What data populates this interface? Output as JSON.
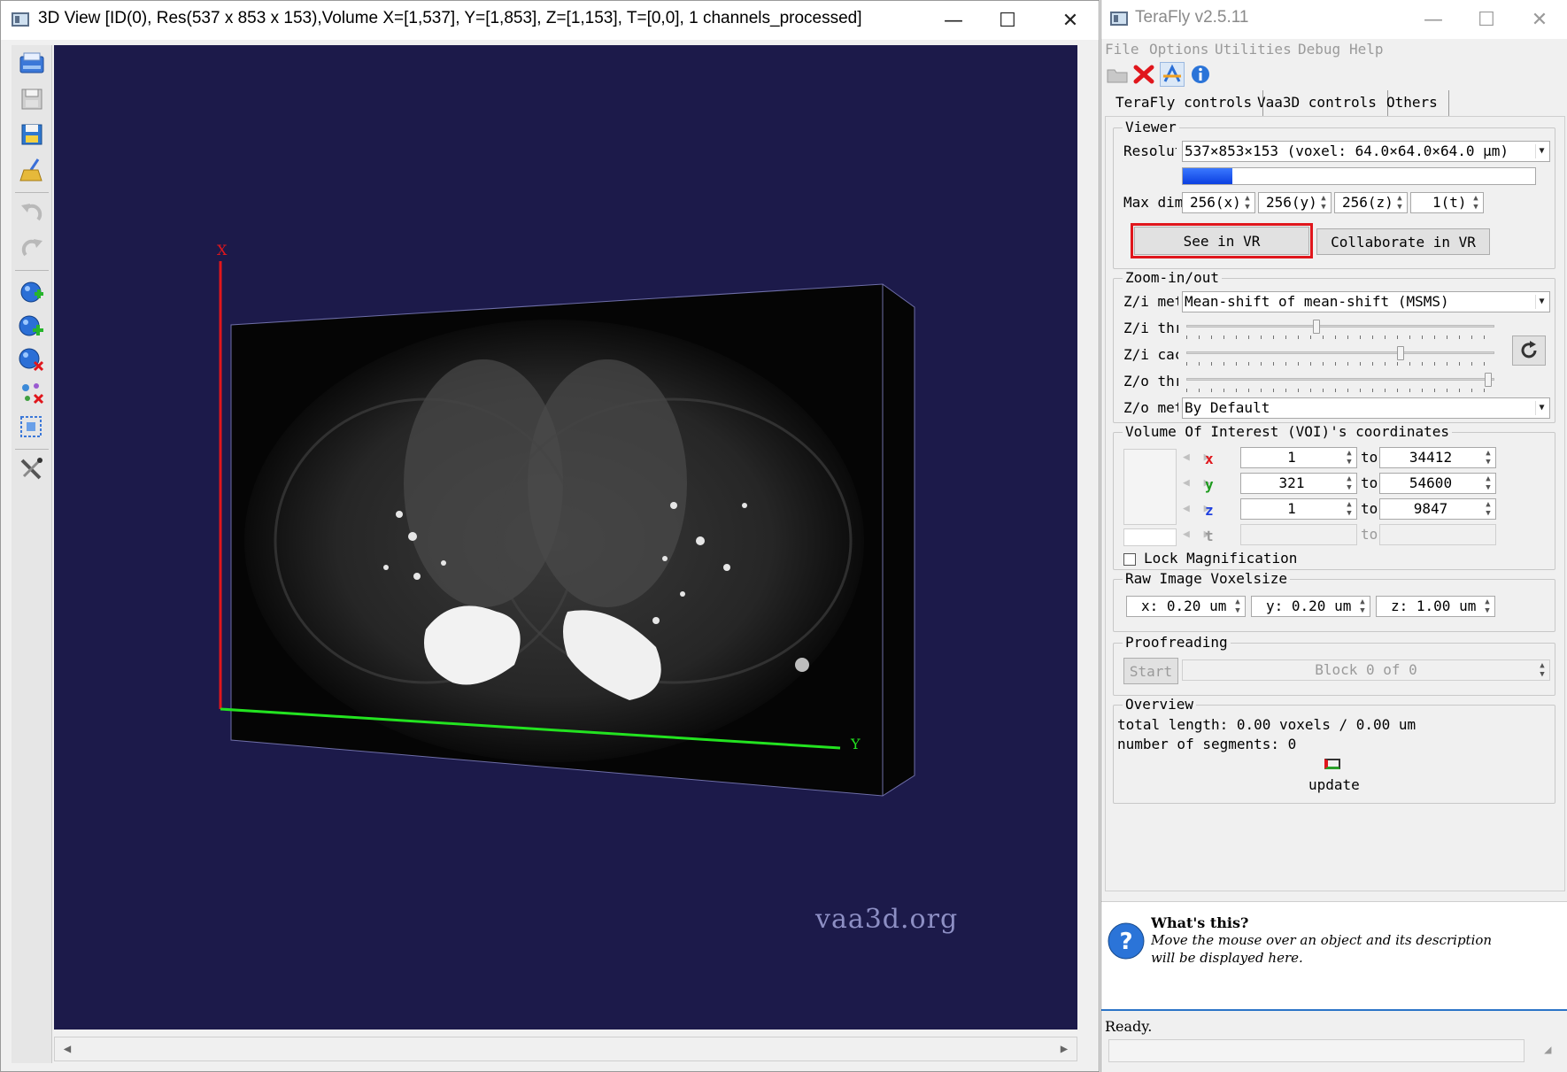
{
  "view_window": {
    "title": "3D View [ID(0), Res(537 x 853 x 153),Volume X=[1,537], Y=[1,853], Z=[1,153], T=[0,0], 1 channels_processed]",
    "minimize": "—",
    "maximize": "☐",
    "close": "✕",
    "toolbar_icons": [
      "screenshot-icon",
      "save-icon",
      "save-as-icon",
      "clean-icon",
      "undo-icon",
      "redo-icon",
      "load-surface-icon",
      "add-marker-icon",
      "delete-marker-icon",
      "neuron-tools-icon",
      "zoom-region-icon",
      "settings-icon"
    ],
    "axis_x_label": "X",
    "axis_y_label": "Y",
    "watermark": "vaa3d.org",
    "colors": {
      "background": "#1c1a4a",
      "axis_x": "#e0161c",
      "axis_y": "#23e320"
    }
  },
  "terafly": {
    "title": "TeraFly v2.5.11",
    "minimize": "—",
    "maximize": "☐",
    "close": "✕",
    "menu": [
      "File",
      "Options",
      "Utilities",
      "Debug",
      "Help"
    ],
    "tabs": [
      "TeraFly controls",
      "Vaa3D controls",
      "Others"
    ],
    "viewer": {
      "title": "Viewer",
      "resolution_label": "Resolut",
      "resolution_value": "537×853×153 (voxel: 64.0×64.0×64.0 μm)",
      "progress": 0.14,
      "maxdim_label": "Max dim",
      "maxdim": [
        "256(x)",
        "256(y)",
        "256(z)",
        "1(t)"
      ],
      "see_vr": "See in VR",
      "collaborate_vr": "Collaborate in VR",
      "highlight_color": "#e0161c"
    },
    "zoom": {
      "title": "Zoom-in/out",
      "zi_method_label": "Z/i metl",
      "zi_method_value": "Mean-shift of mean-shift (MSMS)",
      "zi_threshold_label": "Z/i thr",
      "zi_threshold": 0.42,
      "zi_cache_label": "Z/i cacl",
      "zi_cache": 0.7,
      "zo_threshold_label": "Z/o thr",
      "zo_threshold": 0.99,
      "zo_method_label": "Z/o metl",
      "zo_method_value": "By Default"
    },
    "voi": {
      "title": "Volume Of Interest (VOI)'s coordinates",
      "to": "to",
      "rows": [
        {
          "axis": "x",
          "from": "1",
          "to": "34412",
          "color": "#e0161c"
        },
        {
          "axis": "y",
          "from": "321",
          "to": "54600",
          "color": "#1c9a1c"
        },
        {
          "axis": "z",
          "from": "1",
          "to": "9847",
          "color": "#2040e0"
        },
        {
          "axis": "t",
          "from": "",
          "to": "",
          "color": "#9a9a9a"
        }
      ],
      "lock_label": "Lock Magnification"
    },
    "voxel": {
      "title": "Raw Image Voxelsize",
      "x": "x: 0.20 um",
      "y": "y: 0.20 um",
      "z": "z: 1.00 um"
    },
    "proof": {
      "title": "Proofreading",
      "start": "Start",
      "block": "Block 0 of 0"
    },
    "overview": {
      "title": "Overview",
      "line1": "total length: 0.00 voxels / 0.00 um",
      "line2": "number of segments: 0",
      "update": "update"
    },
    "whatsthis": {
      "title": "What's this?",
      "line1": "Move the mouse over an object and its description",
      "line2": "will be displayed here."
    },
    "status": "Ready."
  }
}
